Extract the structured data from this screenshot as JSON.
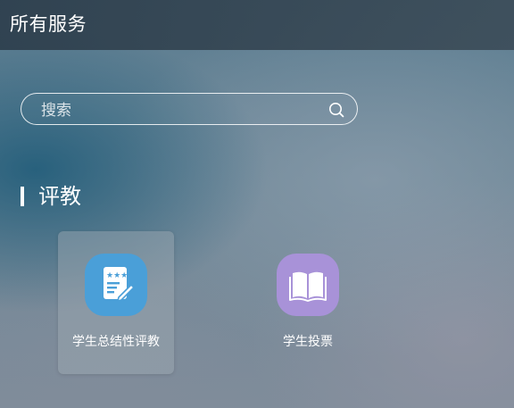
{
  "header": {
    "title": "所有服务"
  },
  "search": {
    "placeholder": "搜索",
    "value": "",
    "icon": "search-icon"
  },
  "section": {
    "title": "评教",
    "items": [
      {
        "label": "学生总结性评教",
        "icon": "evaluation-form-icon",
        "icon_color": "#4a9fd8",
        "highlighted": true
      },
      {
        "label": "学生投票",
        "icon": "open-book-icon",
        "icon_color": "#a892d8",
        "highlighted": false
      }
    ]
  },
  "colors": {
    "header_bg": "#34495a",
    "text": "#ffffff"
  }
}
